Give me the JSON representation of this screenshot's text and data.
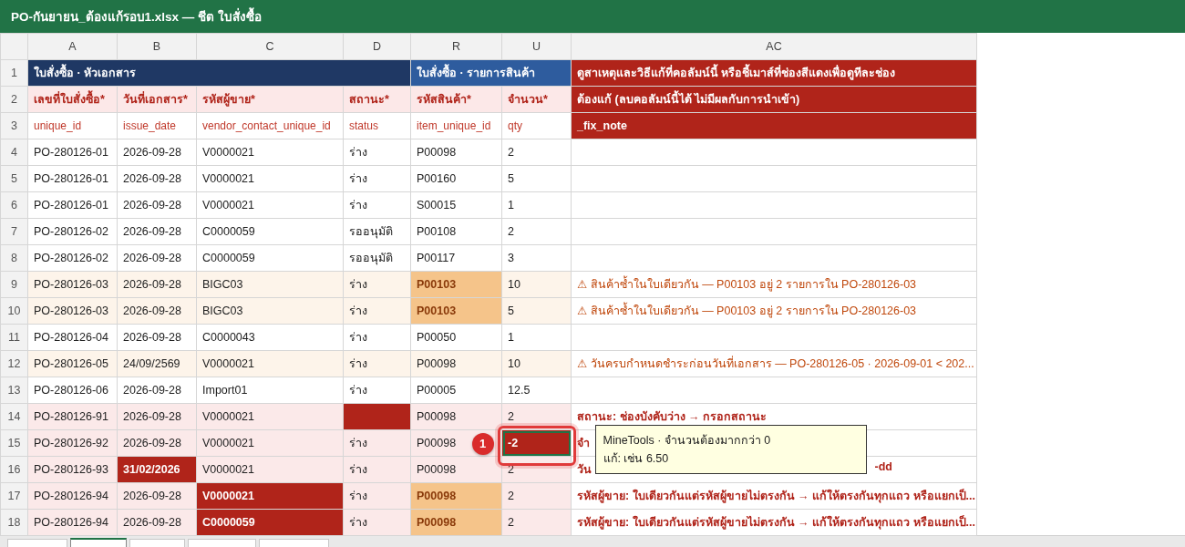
{
  "window": {
    "title": "PO-กันยายน_ต้องแก้รอบ1.xlsx — ชีต ใบสั่งซื้อ"
  },
  "columns": [
    "A",
    "B",
    "C",
    "D",
    "R",
    "U",
    "AC"
  ],
  "group_row": {
    "num": "1",
    "groups": [
      {
        "text": "ใบสั่งซื้อ · หัวเอกสาร",
        "kind": "header"
      },
      {
        "text": "ใบสั่งซื้อ · รายการสินค้า",
        "kind": "lines"
      },
      {
        "text": "ดูสาเหตุและวิธีแก้ที่คอลัมน์นี้ หรือชี้เมาส์ที่ช่องสีแดงเพื่อดูทีละช่อง",
        "kind": "note"
      }
    ]
  },
  "label_row": {
    "num": "2",
    "labels": [
      "เลขที่ใบสั่งซื้อ*",
      "วันที่เอกสาร*",
      "รหัสผู้ขาย*",
      "สถานะ*",
      "รหัสสินค้า*",
      "จำนวน*"
    ],
    "note": "ต้องแก้ (ลบคอลัมน์นี้ได้ ไม่มีผลกับการนำเข้า)"
  },
  "key_row": {
    "num": "3",
    "keys": [
      "unique_id",
      "issue_date",
      "vendor_contact_unique_id",
      "status",
      "item_unique_id",
      "qty"
    ],
    "note": "_fix_note"
  },
  "rows": [
    {
      "num": "4",
      "kind": "plain",
      "cells": [
        {
          "text": "PO-280126-01",
          "kind": "plain",
          "selected": false
        },
        {
          "text": "2026-09-28",
          "kind": "plain",
          "selected": false
        },
        {
          "text": "V0000021",
          "kind": "plain",
          "selected": false
        },
        {
          "text": "ร่าง",
          "kind": "plain",
          "selected": false
        },
        {
          "text": "P00098",
          "kind": "plain",
          "selected": false
        },
        {
          "text": "2",
          "kind": "plain",
          "selected": false
        }
      ]
    },
    {
      "num": "5",
      "kind": "plain",
      "cells": [
        {
          "text": "PO-280126-01",
          "kind": "plain",
          "selected": false
        },
        {
          "text": "2026-09-28",
          "kind": "plain",
          "selected": false
        },
        {
          "text": "V0000021",
          "kind": "plain",
          "selected": false
        },
        {
          "text": "ร่าง",
          "kind": "plain",
          "selected": false
        },
        {
          "text": "P00160",
          "kind": "plain",
          "selected": false
        },
        {
          "text": "5",
          "kind": "plain",
          "selected": false
        }
      ]
    },
    {
      "num": "6",
      "kind": "plain",
      "cells": [
        {
          "text": "PO-280126-01",
          "kind": "plain",
          "selected": false
        },
        {
          "text": "2026-09-28",
          "kind": "plain",
          "selected": false
        },
        {
          "text": "V0000021",
          "kind": "plain",
          "selected": false
        },
        {
          "text": "ร่าง",
          "kind": "plain",
          "selected": false
        },
        {
          "text": "S00015",
          "kind": "plain",
          "selected": false
        },
        {
          "text": "1",
          "kind": "plain",
          "selected": false
        }
      ]
    },
    {
      "num": "7",
      "kind": "plain",
      "cells": [
        {
          "text": "PO-280126-02",
          "kind": "plain",
          "selected": false
        },
        {
          "text": "2026-09-28",
          "kind": "plain",
          "selected": false
        },
        {
          "text": "C0000059",
          "kind": "plain",
          "selected": false
        },
        {
          "text": "รออนุมัติ",
          "kind": "plain",
          "selected": false
        },
        {
          "text": "P00108",
          "kind": "plain",
          "selected": false
        },
        {
          "text": "2",
          "kind": "plain",
          "selected": false
        }
      ]
    },
    {
      "num": "8",
      "kind": "plain",
      "cells": [
        {
          "text": "PO-280126-02",
          "kind": "plain",
          "selected": false
        },
        {
          "text": "2026-09-28",
          "kind": "plain",
          "selected": false
        },
        {
          "text": "C0000059",
          "kind": "plain",
          "selected": false
        },
        {
          "text": "รออนุมัติ",
          "kind": "plain",
          "selected": false
        },
        {
          "text": "P00117",
          "kind": "plain",
          "selected": false
        },
        {
          "text": "3",
          "kind": "plain",
          "selected": false
        }
      ]
    },
    {
      "num": "9",
      "kind": "warn",
      "cells": [
        {
          "text": "PO-280126-03",
          "kind": "plain",
          "selected": false
        },
        {
          "text": "2026-09-28",
          "kind": "plain",
          "selected": false
        },
        {
          "text": "BIGC03",
          "kind": "plain",
          "selected": false
        },
        {
          "text": "ร่าง",
          "kind": "plain",
          "selected": false
        },
        {
          "text": "P00103",
          "kind": "duplicate",
          "selected": false
        },
        {
          "text": "10",
          "kind": "plain",
          "selected": false
        }
      ],
      "note": {
        "text": "⚠ สินค้าซ้ำในใบเดียวกัน — P00103 อยู่ 2 รายการใน PO-280126-03",
        "kind": "warn"
      }
    },
    {
      "num": "10",
      "kind": "warn",
      "cells": [
        {
          "text": "PO-280126-03",
          "kind": "plain",
          "selected": false
        },
        {
          "text": "2026-09-28",
          "kind": "plain",
          "selected": false
        },
        {
          "text": "BIGC03",
          "kind": "plain",
          "selected": false
        },
        {
          "text": "ร่าง",
          "kind": "plain",
          "selected": false
        },
        {
          "text": "P00103",
          "kind": "duplicate",
          "selected": false
        },
        {
          "text": "5",
          "kind": "plain",
          "selected": false
        }
      ],
      "note": {
        "text": "⚠ สินค้าซ้ำในใบเดียวกัน — P00103 อยู่ 2 รายการใน PO-280126-03",
        "kind": "warn"
      }
    },
    {
      "num": "11",
      "kind": "plain",
      "cells": [
        {
          "text": "PO-280126-04",
          "kind": "plain",
          "selected": false
        },
        {
          "text": "2026-09-28",
          "kind": "plain",
          "selected": false
        },
        {
          "text": "C0000043",
          "kind": "plain",
          "selected": false
        },
        {
          "text": "ร่าง",
          "kind": "plain",
          "selected": false
        },
        {
          "text": "P00050",
          "kind": "plain",
          "selected": false
        },
        {
          "text": "1",
          "kind": "plain",
          "selected": false
        }
      ]
    },
    {
      "num": "12",
      "kind": "warn",
      "cells": [
        {
          "text": "PO-280126-05",
          "kind": "plain",
          "selected": false
        },
        {
          "text": "24/09/2569",
          "kind": "plain",
          "selected": false
        },
        {
          "text": "V0000021",
          "kind": "plain",
          "selected": false
        },
        {
          "text": "ร่าง",
          "kind": "plain",
          "selected": false
        },
        {
          "text": "P00098",
          "kind": "plain",
          "selected": false
        },
        {
          "text": "10",
          "kind": "plain",
          "selected": false
        }
      ],
      "note": {
        "text": "⚠ วันครบกำหนดชำระก่อนวันที่เอกสาร — PO-280126-05 · 2026-09-01 < 202...",
        "kind": "warn"
      }
    },
    {
      "num": "13",
      "kind": "plain",
      "cells": [
        {
          "text": "PO-280126-06",
          "kind": "plain",
          "selected": false
        },
        {
          "text": "2026-09-28",
          "kind": "plain",
          "selected": false
        },
        {
          "text": "Import01",
          "kind": "plain",
          "selected": false
        },
        {
          "text": "ร่าง",
          "kind": "plain",
          "selected": false
        },
        {
          "text": "P00005",
          "kind": "plain",
          "selected": false
        },
        {
          "text": "12.5",
          "kind": "plain",
          "selected": false
        }
      ]
    },
    {
      "num": "14",
      "kind": "error",
      "cells": [
        {
          "text": "PO-280126-91",
          "kind": "plain",
          "selected": false
        },
        {
          "text": "2026-09-28",
          "kind": "plain",
          "selected": false
        },
        {
          "text": "V0000021",
          "kind": "plain",
          "selected": false
        },
        {
          "kind": "error",
          "selected": false
        },
        {
          "text": "P00098",
          "kind": "plain",
          "selected": false
        },
        {
          "text": "2",
          "kind": "plain",
          "selected": false
        }
      ],
      "note": {
        "text": "สถานะ: ช่องบังคับว่าง → กรอกสถานะ",
        "kind": "error"
      }
    },
    {
      "num": "15",
      "kind": "error",
      "cells": [
        {
          "text": "PO-280126-92",
          "kind": "plain",
          "selected": false
        },
        {
          "text": "2026-09-28",
          "kind": "plain",
          "selected": false
        },
        {
          "text": "V0000021",
          "kind": "plain",
          "selected": false
        },
        {
          "text": "ร่าง",
          "kind": "plain",
          "selected": false
        },
        {
          "text": "P00098",
          "kind": "plain",
          "selected": false
        },
        {
          "text": "-2",
          "kind": "error",
          "selected": true
        }
      ],
      "note": {
        "text": "จำ",
        "kind": "error"
      }
    },
    {
      "num": "16",
      "kind": "error",
      "cells": [
        {
          "text": "PO-280126-93",
          "kind": "plain",
          "selected": false
        },
        {
          "text": "31/02/2026",
          "kind": "error",
          "selected": false
        },
        {
          "text": "V0000021",
          "kind": "plain",
          "selected": false
        },
        {
          "text": "ร่าง",
          "kind": "plain",
          "selected": false
        },
        {
          "text": "P00098",
          "kind": "plain",
          "selected": false
        },
        {
          "text": "2",
          "kind": "plain",
          "selected": false
        }
      ],
      "note": {
        "text": "วัน",
        "tail": "-dd",
        "kind": "error"
      }
    },
    {
      "num": "17",
      "kind": "error",
      "cells": [
        {
          "text": "PO-280126-94",
          "kind": "plain",
          "selected": false
        },
        {
          "text": "2026-09-28",
          "kind": "plain",
          "selected": false
        },
        {
          "text": "V0000021",
          "kind": "error",
          "selected": false
        },
        {
          "text": "ร่าง",
          "kind": "plain",
          "selected": false
        },
        {
          "text": "P00098",
          "kind": "duplicate",
          "selected": false
        },
        {
          "text": "2",
          "kind": "plain",
          "selected": false
        }
      ],
      "note": {
        "text": "รหัสผู้ขาย: ใบเดียวกันแต่รหัสผู้ขายไม่ตรงกัน → แก้ให้ตรงกันทุกแถว หรือแยกเป็...",
        "kind": "error"
      }
    },
    {
      "num": "18",
      "kind": "error",
      "cells": [
        {
          "text": "PO-280126-94",
          "kind": "plain",
          "selected": false
        },
        {
          "text": "2026-09-28",
          "kind": "plain",
          "selected": false
        },
        {
          "text": "C0000059",
          "kind": "error",
          "selected": false
        },
        {
          "text": "ร่าง",
          "kind": "plain",
          "selected": false
        },
        {
          "text": "P00098",
          "kind": "duplicate",
          "selected": false
        },
        {
          "text": "2",
          "kind": "plain",
          "selected": false
        }
      ],
      "note": {
        "text": "รหัสผู้ขาย: ใบเดียวกันแต่รหัสผู้ขายไม่ตรงกัน → แก้ให้ตรงกันทุกแถว หรือแยกเป็...",
        "kind": "error"
      }
    }
  ],
  "callout": {
    "number": "1"
  },
  "tooltip": {
    "lines": [
      "MineTools · จำนวนต้องมากกว่า 0",
      "แก้: เช่น 6.50"
    ]
  },
  "sheet_tabs": [
    {
      "selected": false
    },
    {
      "selected": true
    },
    {
      "selected": false
    },
    {
      "selected": false
    },
    {
      "selected": false
    }
  ]
}
